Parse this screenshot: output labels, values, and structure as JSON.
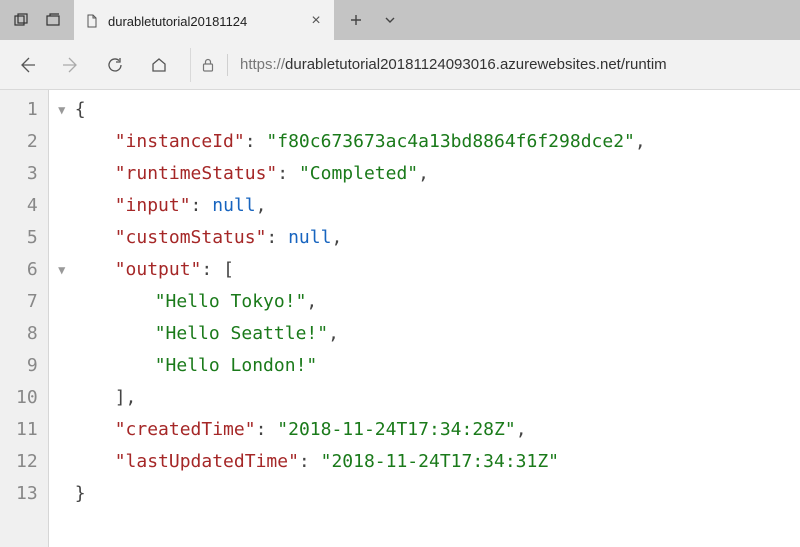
{
  "tab": {
    "title": "durabletutorial20181124"
  },
  "url": {
    "scheme": "https://",
    "rest": "durabletutorial20181124093016.azurewebsites.net/runtim"
  },
  "json_body": {
    "instanceId": "f80c673673ac4a13bd8864f6f298dce2",
    "runtimeStatus": "Completed",
    "input": null,
    "customStatus": null,
    "output": [
      "Hello Tokyo!",
      "Hello Seattle!",
      "Hello London!"
    ],
    "createdTime": "2018-11-24T17:34:28Z",
    "lastUpdatedTime": "2018-11-24T17:34:31Z"
  },
  "code_lines": [
    {
      "n": 1,
      "indent": 0,
      "html": "<span class='p'>{</span>"
    },
    {
      "n": 2,
      "indent": 1,
      "html": "<span class='k'>\"instanceId\"</span><span class='p'>: </span><span class='s'>\"f80c673673ac4a13bd8864f6f298dce2\"</span><span class='p'>,</span>"
    },
    {
      "n": 3,
      "indent": 1,
      "html": "<span class='k'>\"runtimeStatus\"</span><span class='p'>: </span><span class='s'>\"Completed\"</span><span class='p'>,</span>"
    },
    {
      "n": 4,
      "indent": 1,
      "html": "<span class='k'>\"input\"</span><span class='p'>: </span><span class='n'>null</span><span class='p'>,</span>"
    },
    {
      "n": 5,
      "indent": 1,
      "html": "<span class='k'>\"customStatus\"</span><span class='p'>: </span><span class='n'>null</span><span class='p'>,</span>"
    },
    {
      "n": 6,
      "indent": 1,
      "html": "<span class='k'>\"output\"</span><span class='p'>: [</span>"
    },
    {
      "n": 7,
      "indent": 2,
      "html": "<span class='s'>\"Hello Tokyo!\"</span><span class='p'>,</span>"
    },
    {
      "n": 8,
      "indent": 2,
      "html": "<span class='s'>\"Hello Seattle!\"</span><span class='p'>,</span>"
    },
    {
      "n": 9,
      "indent": 2,
      "html": "<span class='s'>\"Hello London!\"</span>"
    },
    {
      "n": 10,
      "indent": 1,
      "html": "<span class='p'>],</span>"
    },
    {
      "n": 11,
      "indent": 1,
      "html": "<span class='k'>\"createdTime\"</span><span class='p'>: </span><span class='s'>\"2018-11-24T17:34:28Z\"</span><span class='p'>,</span>"
    },
    {
      "n": 12,
      "indent": 1,
      "html": "<span class='k'>\"lastUpdatedTime\"</span><span class='p'>: </span><span class='s'>\"2018-11-24T17:34:31Z\"</span>"
    },
    {
      "n": 13,
      "indent": 0,
      "html": "<span class='p'>}</span>"
    }
  ],
  "fold_arrows": {
    "1": "▼",
    "6": "▼"
  }
}
